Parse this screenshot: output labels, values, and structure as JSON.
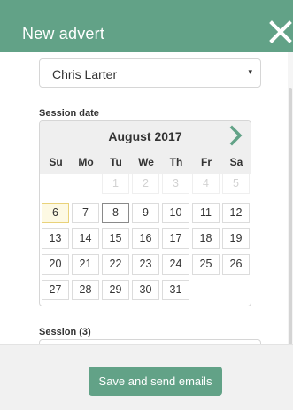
{
  "header": {
    "title": "New advert",
    "close_icon": "close-icon"
  },
  "person_select": {
    "value": "Chris Larter",
    "caret": "▾"
  },
  "session_date": {
    "label": "Session date",
    "month": "August 2017",
    "next_icon": "chevron-right-icon",
    "weekdays": [
      "Su",
      "Mo",
      "Tu",
      "We",
      "Th",
      "Fr",
      "Sa"
    ],
    "weeks": [
      [
        null,
        null,
        "1",
        "2",
        "3",
        "4",
        "5"
      ],
      [
        "6",
        "7",
        "8",
        "9",
        "10",
        "11",
        "12"
      ],
      [
        "13",
        "14",
        "15",
        "16",
        "17",
        "18",
        "19"
      ],
      [
        "20",
        "21",
        "22",
        "23",
        "24",
        "25",
        "26"
      ],
      [
        "27",
        "28",
        "29",
        "30",
        "31",
        null,
        null
      ]
    ],
    "disabled_days": [
      "1",
      "2",
      "3",
      "4",
      "5"
    ],
    "today": "6",
    "selected": "8"
  },
  "session": {
    "label": "Session (3)"
  },
  "footer": {
    "save_label": "Save and send emails"
  },
  "colors": {
    "accent": "#62a287",
    "today_bg": "#fdf9e3",
    "today_border": "#e9d27a"
  }
}
